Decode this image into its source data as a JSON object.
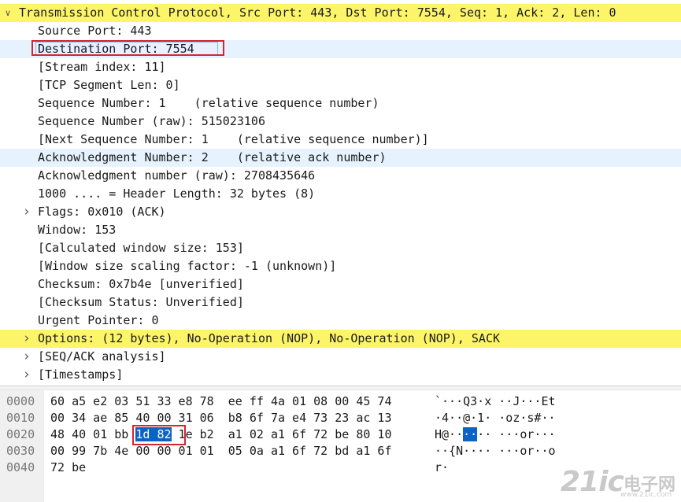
{
  "tree": {
    "rows": [
      {
        "text": "Transmission Control Protocol, Src Port: 443, Dst Port: 7554, Seq: 1, Ack: 2, Len: 0",
        "expander": "down",
        "highlight": "yellow"
      },
      {
        "text": "Source Port: 443"
      },
      {
        "text": "Destination Port: 7554",
        "highlight": "blue",
        "selected": true
      },
      {
        "text": "[Stream index: 11]"
      },
      {
        "text": "[TCP Segment Len: 0]"
      },
      {
        "text": "Sequence Number: 1    (relative sequence number)"
      },
      {
        "text": "Sequence Number (raw): 515023106"
      },
      {
        "text": "[Next Sequence Number: 1    (relative sequence number)]"
      },
      {
        "text": "Acknowledgment Number: 2    (relative ack number)",
        "highlight": "blue"
      },
      {
        "text": "Acknowledgment number (raw): 2708435646"
      },
      {
        "text": "1000 .... = Header Length: 32 bytes (8)"
      },
      {
        "text": "Flags: 0x010 (ACK)",
        "expander": "right"
      },
      {
        "text": "Window: 153"
      },
      {
        "text": "[Calculated window size: 153]"
      },
      {
        "text": "[Window size scaling factor: -1 (unknown)]"
      },
      {
        "text": "Checksum: 0x7b4e [unverified]"
      },
      {
        "text": "[Checksum Status: Unverified]"
      },
      {
        "text": "Urgent Pointer: 0"
      },
      {
        "text": "Options: (12 bytes), No-Operation (NOP), No-Operation (NOP), SACK",
        "expander": "right",
        "highlight": "yellow"
      },
      {
        "text": "[SEQ/ACK analysis]",
        "expander": "right"
      },
      {
        "text": "[Timestamps]",
        "expander": "right"
      }
    ]
  },
  "hexdump": {
    "rows": [
      {
        "offset": "0000",
        "pre": "60 a5 e2 03 51 33 e8 78  ee ff 4a 01 08 00 45 74",
        "hex_mark": "",
        "post": "",
        "ascii_pre": "`···Q3·x ··J···Et",
        "ascii_mark": "",
        "ascii_post": ""
      },
      {
        "offset": "0010",
        "pre": "00 34 ae 85 40 00 31 06  b8 6f 7a e4 73 23 ac 13",
        "hex_mark": "",
        "post": "",
        "ascii_pre": "·4··@·1· ·oz·s#··",
        "ascii_mark": "",
        "ascii_post": ""
      },
      {
        "offset": "0020",
        "pre": "48 40 01 bb ",
        "hex_mark": "1d 82",
        "post": " 1e b2  a1 02 a1 6f 72 be 80 10",
        "ascii_pre": "H@··",
        "ascii_mark": "··",
        "ascii_post": "·· ···or···"
      },
      {
        "offset": "0030",
        "pre": "00 99 7b 4e 00 00 01 01  05 0a a1 6f 72 bd a1 6f",
        "hex_mark": "",
        "post": "",
        "ascii_pre": "··{N···· ···or··o",
        "ascii_mark": "",
        "ascii_post": ""
      },
      {
        "offset": "0040",
        "pre": "72 be",
        "hex_mark": "",
        "post": "",
        "ascii_pre": "r·",
        "ascii_mark": "",
        "ascii_post": ""
      }
    ]
  },
  "watermark": {
    "logo": "21ic",
    "cn": "电子网",
    "url": "www.21ic.com"
  },
  "icons": {
    "expanded": "chevron-down-icon",
    "collapsed": "chevron-right-icon"
  },
  "colors": {
    "yellow_highlight": "#fcf56a",
    "blue_highlight": "#e6f2fd",
    "selection_box": "#d9232e",
    "hex_selection": "#0a64c8"
  }
}
